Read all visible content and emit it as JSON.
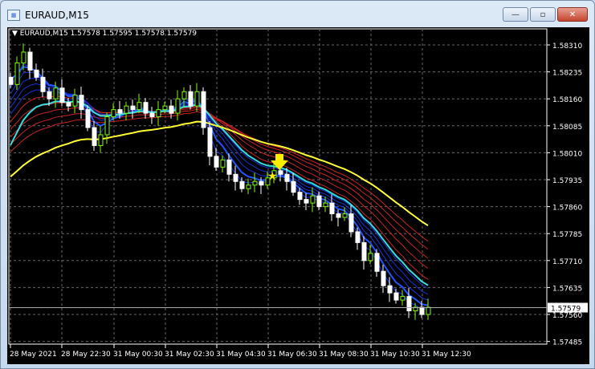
{
  "window": {
    "title": "EURAUD,M15",
    "minimize": "—",
    "maximize": "▫",
    "close": "✕"
  },
  "chart": {
    "symbol_line": "EURAUD,M15  1.57578 1.57595 1.57578 1.57579",
    "price_labels": [
      "1.58310",
      "1.58235",
      "1.58160",
      "1.58085",
      "1.58010",
      "1.57935",
      "1.57860",
      "1.57785",
      "1.57710",
      "1.57635",
      "1.57560",
      "1.57485"
    ],
    "current_price": "1.57579",
    "time_labels": [
      "28 May 2021",
      "28 May 22:30",
      "31 May 00:30",
      "31 May 02:30",
      "31 May 04:30",
      "31 May 06:30",
      "31 May 08:30",
      "31 May 10:30",
      "31 May 12:30"
    ],
    "closes": [
      1.582,
      1.5826,
      1.5829,
      1.5824,
      1.5822,
      1.5818,
      1.5816,
      1.5819,
      1.5815,
      1.5814,
      1.5817,
      1.5813,
      1.5808,
      1.5803,
      1.5806,
      1.5811,
      1.5813,
      1.5812,
      1.5814,
      1.5813,
      1.5815,
      1.5812,
      1.5811,
      1.5813,
      1.5814,
      1.5812,
      1.5816,
      1.5818,
      1.5814,
      1.5818,
      1.5808,
      1.58,
      1.5797,
      1.5799,
      1.5795,
      1.5793,
      1.5791,
      1.5792,
      1.5793,
      1.5792,
      1.5794,
      1.5796,
      1.5795,
      1.5793,
      1.579,
      1.5788,
      1.5787,
      1.5789,
      1.5786,
      1.5787,
      1.5784,
      1.5783,
      1.5784,
      1.5779,
      1.5776,
      1.5771,
      1.5773,
      1.5768,
      1.5764,
      1.5762,
      1.576,
      1.5761,
      1.5757,
      1.5758,
      1.5756,
      1.5758
    ],
    "colors": {
      "bull": "#7cfc00",
      "bear": "#ffffff",
      "slow_ma": "#ffff33",
      "mid_ma": "#33dddd",
      "red_fan": "#cc2222",
      "blue_fan": "#1133dd",
      "signal": "#ffee00"
    }
  }
}
